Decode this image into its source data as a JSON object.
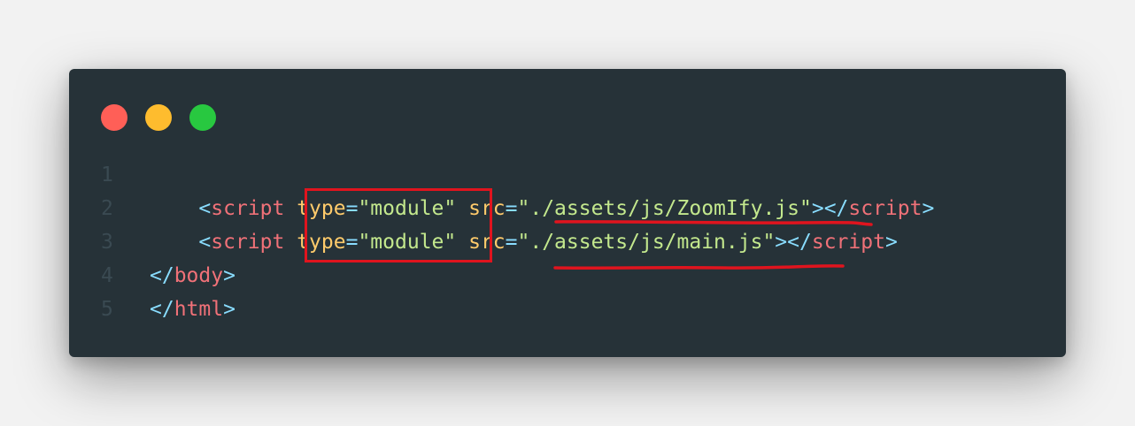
{
  "window_controls": {
    "close_color": "#ff5f57",
    "minimize_color": "#febc2e",
    "maximize_color": "#28c840"
  },
  "code": {
    "lines": [
      {
        "number": "1",
        "indent": "",
        "tokens": []
      },
      {
        "number": "2",
        "indent": "    ",
        "tokens": [
          {
            "text": "<",
            "kind": "punct"
          },
          {
            "text": "script",
            "kind": "tag"
          },
          {
            "text": " ",
            "kind": "text"
          },
          {
            "text": "type",
            "kind": "attr"
          },
          {
            "text": "=",
            "kind": "punct"
          },
          {
            "text": "\"module\"",
            "kind": "str"
          },
          {
            "text": " ",
            "kind": "text"
          },
          {
            "text": "src",
            "kind": "attr"
          },
          {
            "text": "=",
            "kind": "punct"
          },
          {
            "text": "\"./assets/js/ZoomIfy.js\"",
            "kind": "str"
          },
          {
            "text": "></",
            "kind": "punct"
          },
          {
            "text": "script",
            "kind": "tag"
          },
          {
            "text": ">",
            "kind": "punct"
          }
        ]
      },
      {
        "number": "3",
        "indent": "    ",
        "tokens": [
          {
            "text": "<",
            "kind": "punct"
          },
          {
            "text": "script",
            "kind": "tag"
          },
          {
            "text": " ",
            "kind": "text"
          },
          {
            "text": "type",
            "kind": "attr"
          },
          {
            "text": "=",
            "kind": "punct"
          },
          {
            "text": "\"module\"",
            "kind": "str"
          },
          {
            "text": " ",
            "kind": "text"
          },
          {
            "text": "src",
            "kind": "attr"
          },
          {
            "text": "=",
            "kind": "punct"
          },
          {
            "text": "\"./assets/js/main.js\"",
            "kind": "str"
          },
          {
            "text": "></",
            "kind": "punct"
          },
          {
            "text": "script",
            "kind": "tag"
          },
          {
            "text": ">",
            "kind": "punct"
          }
        ]
      },
      {
        "number": "4",
        "indent": "",
        "tokens": [
          {
            "text": "</",
            "kind": "punct"
          },
          {
            "text": "body",
            "kind": "tag"
          },
          {
            "text": ">",
            "kind": "punct"
          }
        ]
      },
      {
        "number": "5",
        "indent": "",
        "tokens": [
          {
            "text": "</",
            "kind": "punct"
          },
          {
            "text": "html",
            "kind": "tag"
          },
          {
            "text": ">",
            "kind": "punct"
          }
        ]
      }
    ]
  },
  "annotations": {
    "color": "#e0141e"
  }
}
